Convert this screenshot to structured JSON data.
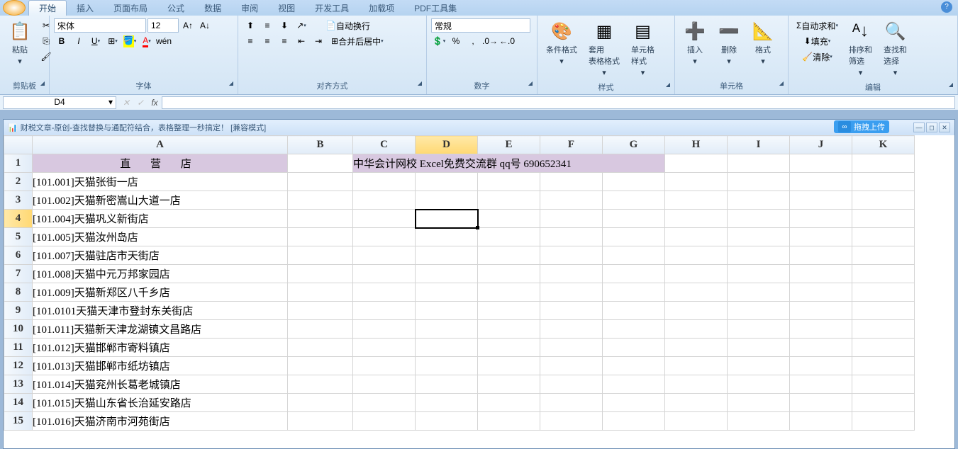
{
  "tabs": [
    "开始",
    "插入",
    "页面布局",
    "公式",
    "数据",
    "审阅",
    "视图",
    "开发工具",
    "加载项",
    "PDF工具集"
  ],
  "activeTab": 0,
  "ribbon": {
    "clipboard": {
      "label": "剪贴板",
      "paste": "粘贴"
    },
    "font": {
      "label": "字体",
      "name": "宋体",
      "size": "12"
    },
    "align": {
      "label": "对齐方式",
      "wrap": "自动换行",
      "merge": "合并后居中"
    },
    "number": {
      "label": "数字",
      "format": "常规"
    },
    "styles": {
      "label": "样式",
      "cond": "条件格式",
      "table": "套用\n表格格式",
      "cell": "单元格\n样式"
    },
    "cells": {
      "label": "单元格",
      "insert": "插入",
      "delete": "删除",
      "format": "格式"
    },
    "editing": {
      "label": "编辑",
      "sum": "自动求和",
      "fill": "填充",
      "clear": "清除",
      "sort": "排序和\n筛选",
      "find": "查找和\n选择"
    }
  },
  "nameBox": "D4",
  "formula": "",
  "workbook": {
    "title": "财税文章-原创-查找替换与通配符结合，表格整理一秒搞定！  [兼容模式]",
    "cloudBadge": "拖拽上传"
  },
  "columns": [
    "A",
    "B",
    "C",
    "D",
    "E",
    "F",
    "G",
    "H",
    "I",
    "J",
    "K"
  ],
  "activeCol": "D",
  "activeRow": 4,
  "cells": {
    "A1": "直 营 店",
    "C1_banner": "中华会计网校 Excel免费交流群 qq号 690652341"
  },
  "rows": [
    "[101.001]天猫张街一店",
    "[101.002]天猫新密嵩山大道一店",
    "[101.004]天猫巩义新街店",
    "[101.005]天猫汝州岛店",
    "[101.007]天猫驻店市天街店",
    "[101.008]天猫中元万邦家园店",
    "[101.009]天猫新郑区八千乡店",
    "[101.0101天猫天津市登封东关街店",
    "[101.011]天猫新天津龙湖镇文昌路店",
    "[101.012]天猫邯郸市寄料镇店",
    "[101.013]天猫邯郸市纸坊镇店",
    "[101.014]天猫兖州长葛老城镇店",
    "[101.015]天猫山东省长治延安路店",
    "[101.016]天猫济南市河苑街店"
  ]
}
